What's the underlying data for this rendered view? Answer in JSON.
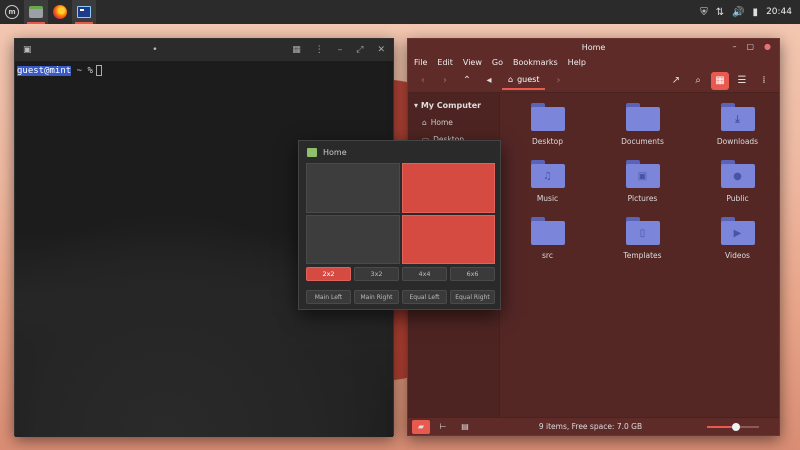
{
  "panel": {
    "apps": [
      {
        "icon": "mint-menu-icon"
      },
      {
        "icon": "files-icon"
      },
      {
        "icon": "firefox-icon"
      },
      {
        "icon": "terminal-icon"
      }
    ],
    "tray": {
      "shield": "⛨",
      "network": "⇅",
      "volume": "🔊",
      "battery": "▮",
      "clock": "20:44"
    }
  },
  "terminal": {
    "user_host": "guest@mint",
    "prompt_rest": " ~ %",
    "controls": {
      "menu": "⋮",
      "grid": "▦",
      "minimize": "–",
      "maximize": "⤢",
      "close": "✕",
      "dot": "•"
    }
  },
  "nemo": {
    "title": "Home",
    "menu": [
      "File",
      "Edit",
      "View",
      "Go",
      "Bookmarks",
      "Help"
    ],
    "breadcrumb": "guest",
    "sidebar": {
      "header": "My Computer",
      "items": [
        "Home",
        "Desktop"
      ]
    },
    "folders": [
      {
        "name": "Desktop",
        "glyph": ""
      },
      {
        "name": "Documents",
        "glyph": ""
      },
      {
        "name": "Downloads",
        "glyph": "⤓"
      },
      {
        "name": "Music",
        "glyph": "♫"
      },
      {
        "name": "Pictures",
        "glyph": "▣"
      },
      {
        "name": "Public",
        "glyph": "●"
      },
      {
        "name": "src",
        "glyph": ""
      },
      {
        "name": "Templates",
        "glyph": "▯"
      },
      {
        "name": "Videos",
        "glyph": "▶"
      }
    ],
    "status_text": "9 items, Free space: 7.0 GB",
    "zoom_fraction": 0.55
  },
  "gtile": {
    "title": "Home",
    "presets": [
      "2x2",
      "3x2",
      "4x4",
      "6x6"
    ],
    "active_preset": "2x2",
    "actions": [
      "Main Left",
      "Main Right",
      "Equal Left",
      "Equal Right"
    ]
  }
}
